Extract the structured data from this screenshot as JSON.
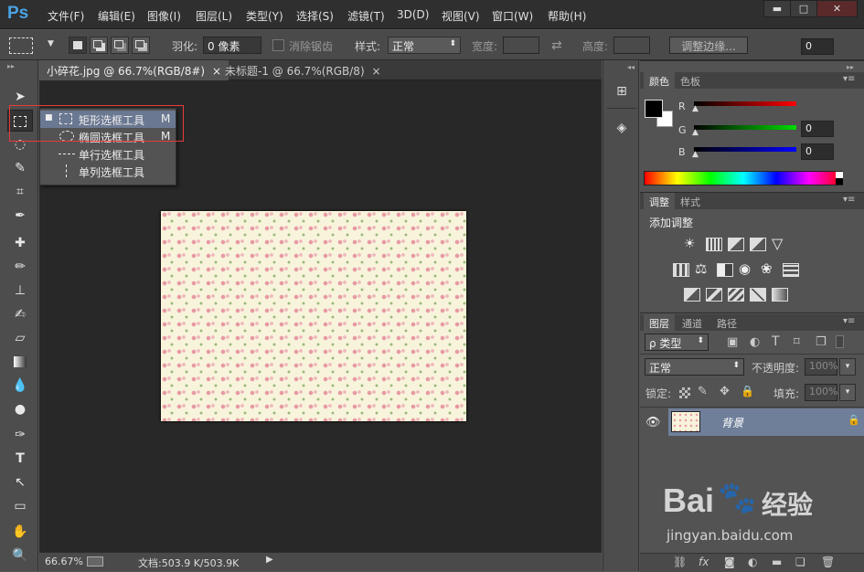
{
  "app_logo": "Ps",
  "menu": [
    "文件(F)",
    "编辑(E)",
    "图像(I)",
    "图层(L)",
    "类型(Y)",
    "选择(S)",
    "滤镜(T)",
    "3D(D)",
    "视图(V)",
    "窗口(W)",
    "帮助(H)"
  ],
  "window_controls": {
    "minimize": "▬",
    "maximize": "□",
    "close": "✕"
  },
  "options": {
    "feather_label": "羽化:",
    "feather_value": "0 像素",
    "antialias_label": "消除锯齿",
    "style_label": "样式:",
    "style_value": "正常",
    "width_label": "宽度:",
    "height_label": "高度:",
    "refine_button": "调整边缘..."
  },
  "tabs": [
    {
      "label": "小碎花.jpg @ 66.7%(RGB/8#)",
      "close": "×"
    },
    {
      "label": "未标题-1 @ 66.7%(RGB/8)",
      "close": "×"
    }
  ],
  "flyout": [
    {
      "label": "矩形选框工具",
      "key": "M",
      "selected": true
    },
    {
      "label": "椭圆选框工具",
      "key": "M",
      "selected": false
    },
    {
      "label": "单行选框工具",
      "key": "",
      "selected": false
    },
    {
      "label": "单列选框工具",
      "key": "",
      "selected": false
    }
  ],
  "status": {
    "zoom": "66.67%",
    "doc": "文档:503.9 K/503.9K"
  },
  "color_panel": {
    "tabs": [
      "颜色",
      "色板"
    ],
    "channels": [
      {
        "name": "R",
        "value": "0",
        "color": "#e02020"
      },
      {
        "name": "G",
        "value": "0",
        "color": "#20c020"
      },
      {
        "name": "B",
        "value": "0",
        "color": "#2020e0"
      }
    ]
  },
  "adjust_panel": {
    "tabs": [
      "调整",
      "样式"
    ],
    "title": "添加调整"
  },
  "layers_panel": {
    "tabs": [
      "图层",
      "通道",
      "路径"
    ],
    "filter_value": "ρ 类型",
    "blend_value": "正常",
    "opacity_label": "不透明度:",
    "opacity_value": "100%",
    "lock_label": "锁定:",
    "fill_label": "填充:",
    "fill_value": "100%",
    "layer_name": "背景"
  },
  "watermark": {
    "brand": "Bai",
    "brand2": "经验",
    "url": "jingyan.baidu.com"
  }
}
